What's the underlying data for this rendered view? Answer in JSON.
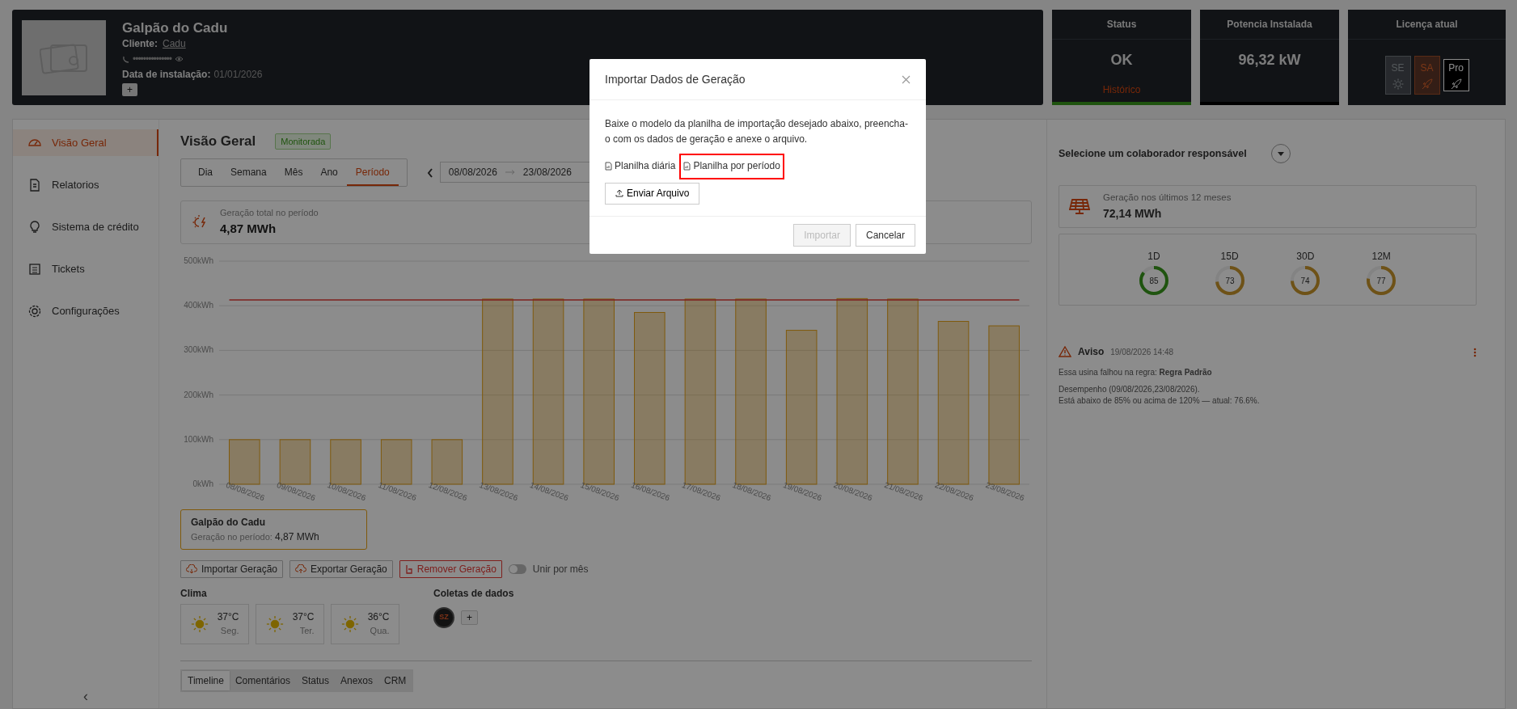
{
  "header": {
    "title": "Galpão do Cadu",
    "client_label": "Cliente:",
    "client": "Cadu",
    "phone": "•••••••••••••••",
    "install_label": "Data de instalação:",
    "install_date": "01/01/2026",
    "add_button": "+"
  },
  "stat_cards": [
    {
      "kind": "status",
      "title": "Status",
      "value": "OK",
      "link": "Histórico"
    },
    {
      "kind": "power",
      "title": "Potencia Instalada",
      "value": "96,32 kW"
    }
  ],
  "license": {
    "title": "Licença atual",
    "plans": [
      {
        "label": "SE",
        "selected": false
      },
      {
        "label": "SA",
        "selected": false
      },
      {
        "label": "Pro",
        "selected": true
      }
    ]
  },
  "sidebar": {
    "items": [
      {
        "label": "Visão Geral",
        "selected": true
      },
      {
        "label": "Relatorios",
        "selected": false
      },
      {
        "label": "Sistema de crédito",
        "selected": false
      },
      {
        "label": "Tickets",
        "selected": false
      },
      {
        "label": "Configurações",
        "selected": false
      }
    ],
    "collapse": "‹"
  },
  "overview": {
    "title": "Visão Geral",
    "badge": "Monitorada",
    "period_tabs": [
      {
        "label": "Dia",
        "selected": false
      },
      {
        "label": "Semana",
        "selected": false
      },
      {
        "label": "Mês",
        "selected": false
      },
      {
        "label": "Ano",
        "selected": false
      },
      {
        "label": "Período",
        "selected": true
      }
    ],
    "date_start": "08/08/2026",
    "date_end": "23/08/2026",
    "total": {
      "label": "Geração total no período",
      "value": "4,87 MWh"
    },
    "chart_data": {
      "type": "bar",
      "categories": [
        "08/08/2026",
        "09/08/2026",
        "10/08/2026",
        "11/08/2026",
        "12/08/2026",
        "13/08/2026",
        "14/08/2026",
        "15/08/2026",
        "16/08/2026",
        "17/08/2026",
        "18/08/2026",
        "19/08/2026",
        "20/08/2026",
        "21/08/2026",
        "22/08/2026",
        "23/08/2026"
      ],
      "series": [
        {
          "name": "Galpão do Cadu",
          "color": "#e8a317",
          "values": [
            100,
            100,
            100,
            100,
            100,
            415,
            415,
            415,
            385,
            415,
            415,
            345,
            416,
            415,
            365,
            355
          ]
        }
      ],
      "ylim": [
        0,
        500
      ],
      "yticks": [
        {
          "value": 0,
          "label": "0kWh"
        },
        {
          "value": 100,
          "label": "100kWh"
        },
        {
          "value": 200,
          "label": "200kWh"
        },
        {
          "value": 300,
          "label": "300kWh"
        },
        {
          "value": 400,
          "label": "400kWh"
        },
        {
          "value": 500,
          "label": "500kWh"
        }
      ],
      "grid": true,
      "ref_lines": [
        {
          "axis": "y",
          "value": 413
        }
      ]
    },
    "legend": {
      "label": "Geração no período:",
      "value": "4,87 MWh"
    },
    "actions": [
      {
        "label": "Importar Geração",
        "kind": "import"
      },
      {
        "label": "Exportar Geração",
        "kind": "export"
      },
      {
        "label": "Remover Geração",
        "kind": "remove"
      }
    ],
    "toggle": {
      "label": "Unir por mês",
      "on": false
    },
    "climate": {
      "title": "Clima",
      "days": [
        {
          "temp": "37°C",
          "day": "Seg."
        },
        {
          "temp": "37°C",
          "day": "Ter."
        },
        {
          "temp": "36°C",
          "day": "Qua."
        }
      ]
    },
    "collections": {
      "title": "Coletas de dados",
      "avatar": "SZ",
      "add_button": "+"
    },
    "bottom_tabs": [
      {
        "label": "Timeline",
        "selected": true
      },
      {
        "label": "Comentários",
        "selected": false
      },
      {
        "label": "Status",
        "selected": false
      },
      {
        "label": "Anexos",
        "selected": false
      },
      {
        "label": "CRM",
        "selected": false
      }
    ]
  },
  "right_panel": {
    "collaborator": "Selecione um colaborador responsável",
    "last12": {
      "label": "Geração nos últimos 12 meses",
      "value": "72,14 MWh"
    },
    "gauges": [
      {
        "label": "1D",
        "value": "85",
        "level": 0.85
      },
      {
        "label": "15D",
        "value": "73",
        "level": 0.73
      },
      {
        "label": "30D",
        "value": "74",
        "level": 0.74
      },
      {
        "label": "12M",
        "value": "77",
        "level": 0.77
      }
    ],
    "alert": {
      "title": "Aviso",
      "datetime": "19/08/2026 14:48",
      "rule": "Essa usina falhou na regra: **Regra Padrão**",
      "lines": [
        "Desempenho (09/08/2026,23/08/2026).",
        "Está abaixo de 85% ou acima de 120% — atual: 76.6%."
      ]
    }
  },
  "modal": {
    "title": "Importar Dados de Geração",
    "description": "Baixe o modelo da planilha de importação desejado abaixo, preencha-o com os dados de geração e anexe o arquivo.",
    "templates": [
      {
        "label": "Planilha diária",
        "highlighted": false
      },
      {
        "label": "Planilha por período",
        "highlighted": true
      }
    ],
    "upload_button": "Enviar Arquivo",
    "buttons": [
      {
        "label": "Importar",
        "disabled": true
      },
      {
        "label": "Cancelar",
        "disabled": false
      }
    ]
  }
}
